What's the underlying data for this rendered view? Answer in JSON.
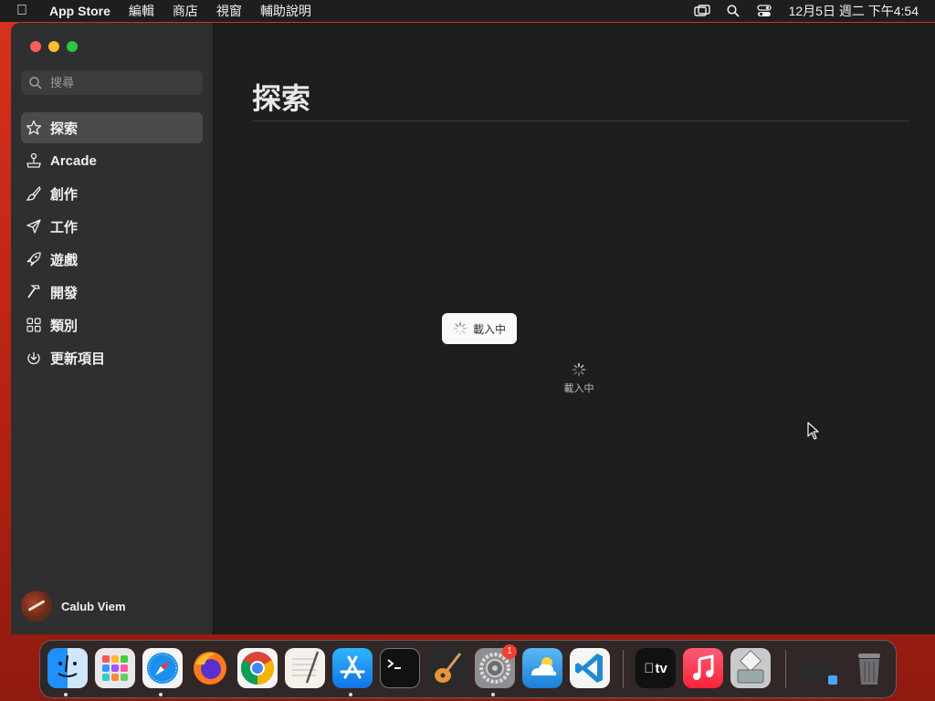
{
  "menubar": {
    "app_name": "App Store",
    "menus": [
      "編輯",
      "商店",
      "視窗",
      "輔助說明"
    ],
    "clock": "12月5日 週二 下午4:54"
  },
  "sidebar": {
    "search_placeholder": "搜尋",
    "items": [
      {
        "label": "探索",
        "icon": "star-icon",
        "active": true
      },
      {
        "label": "Arcade",
        "icon": "joystick-icon",
        "active": false
      },
      {
        "label": "創作",
        "icon": "paintbrush-icon",
        "active": false
      },
      {
        "label": "工作",
        "icon": "paperplane-icon",
        "active": false
      },
      {
        "label": "遊戲",
        "icon": "rocket-icon",
        "active": false
      },
      {
        "label": "開發",
        "icon": "hammer-icon",
        "active": false
      },
      {
        "label": "類別",
        "icon": "grid-icon",
        "active": false
      },
      {
        "label": "更新項目",
        "icon": "download-icon",
        "active": false
      }
    ],
    "user_name": "Calub Viem"
  },
  "main": {
    "title": "探索",
    "toast_text": "載入中",
    "loading_text": "載入中"
  },
  "dock": {
    "items": [
      "finder-icon",
      "launchpad-icon",
      "safari-icon",
      "firefox-icon",
      "chrome-icon",
      "textedit-icon",
      "appstore-icon",
      "terminal-icon",
      "garageband-icon",
      "system-settings-icon",
      "icloud-weather-icon",
      "vscode-icon",
      "appletv-icon",
      "music-icon",
      "migration-assistant-icon",
      "downloads-folder-icon",
      "trash-icon"
    ],
    "system_settings_badge": "1",
    "appletv_label": "tv"
  }
}
